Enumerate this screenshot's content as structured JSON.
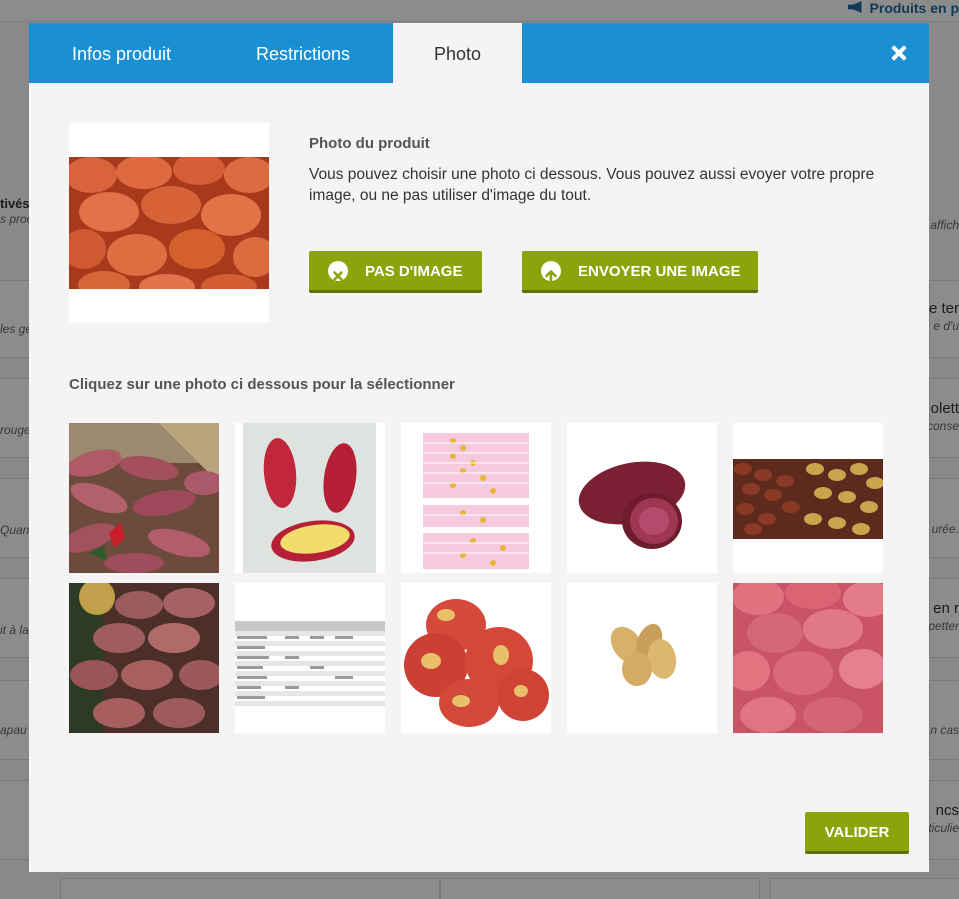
{
  "background": {
    "header_title": "Produits en p",
    "left_texts": [
      {
        "text": "tivés",
        "sub": "s prod"
      },
      {
        "text": "",
        "sub": "les ge"
      },
      {
        "text": "",
        "sub": "rouge"
      },
      {
        "text": "",
        "sub": "Quanti"
      },
      {
        "text": "",
        "sub": "it à la"
      },
      {
        "text": "",
        "sub": "apau"
      }
    ],
    "right_texts": [
      {
        "text": "",
        "sub": "affich"
      },
      {
        "text": "e ter",
        "sub": "e d'u"
      },
      {
        "text": "olett",
        "sub": "conse"
      },
      {
        "text": "",
        "sub": "urée."
      },
      {
        "text": "en r",
        "sub": "petter"
      },
      {
        "text": "",
        "sub": "n cas"
      },
      {
        "text": "ncs",
        "sub": "ticulie"
      }
    ]
  },
  "modal": {
    "tabs": [
      {
        "label": "Infos produit"
      },
      {
        "label": "Restrictions"
      },
      {
        "label": "Photo"
      }
    ],
    "active_tab": "Photo",
    "photo_section": {
      "title": "Photo du produit",
      "description": "Vous pouvez choisir une photo ci dessous. Vous pouvez aussi evoyer votre propre image, ou ne pas utiliser d'image du tout.",
      "no_image_button": "PAS D'IMAGE",
      "upload_button": "ENVOYER UNE IMAGE"
    },
    "select_label": "Cliquez sur une photo ci dessous pour la sélectionner",
    "validate_button": "VALIDER"
  },
  "colors": {
    "header_blue": "#1a90d2",
    "button_green": "#8aa50b",
    "button_green_dark": "#5d7206"
  },
  "icons": [
    "close-icon",
    "remove-circle-icon",
    "upload-arrow-icon",
    "megaphone-icon"
  ]
}
